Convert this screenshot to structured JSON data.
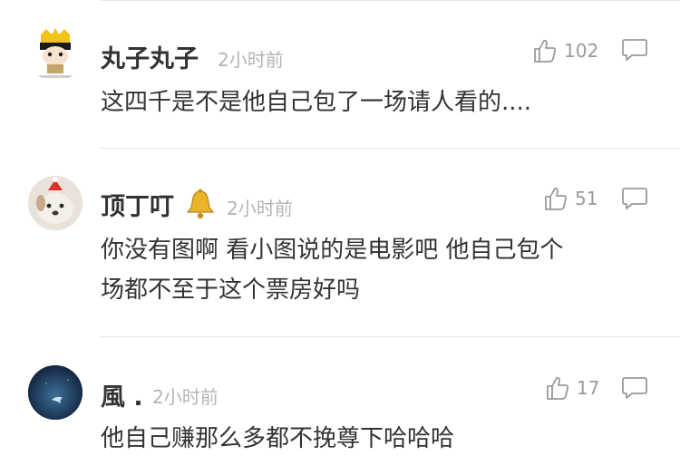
{
  "comments": [
    {
      "username": "丸子丸子",
      "time": "2小时前",
      "likes": "102",
      "lines": [
        "这四千是不是他自己包了一场请人看的...."
      ]
    },
    {
      "username": "顶丁叮",
      "time": "2小时前",
      "likes": "51",
      "lines": [
        "你没有图啊 看小图说的是电影吧 他自己包个",
        "场都不至于这个票房好吗"
      ]
    },
    {
      "username": "風 .",
      "time": "2小时前",
      "likes": "17",
      "lines": [
        "他自己赚那么多都不挽尊下哈哈哈"
      ]
    }
  ],
  "icons": {
    "like": "thumbs-up-icon",
    "reply": "comment-bubble-icon",
    "badge": "bell-icon"
  }
}
